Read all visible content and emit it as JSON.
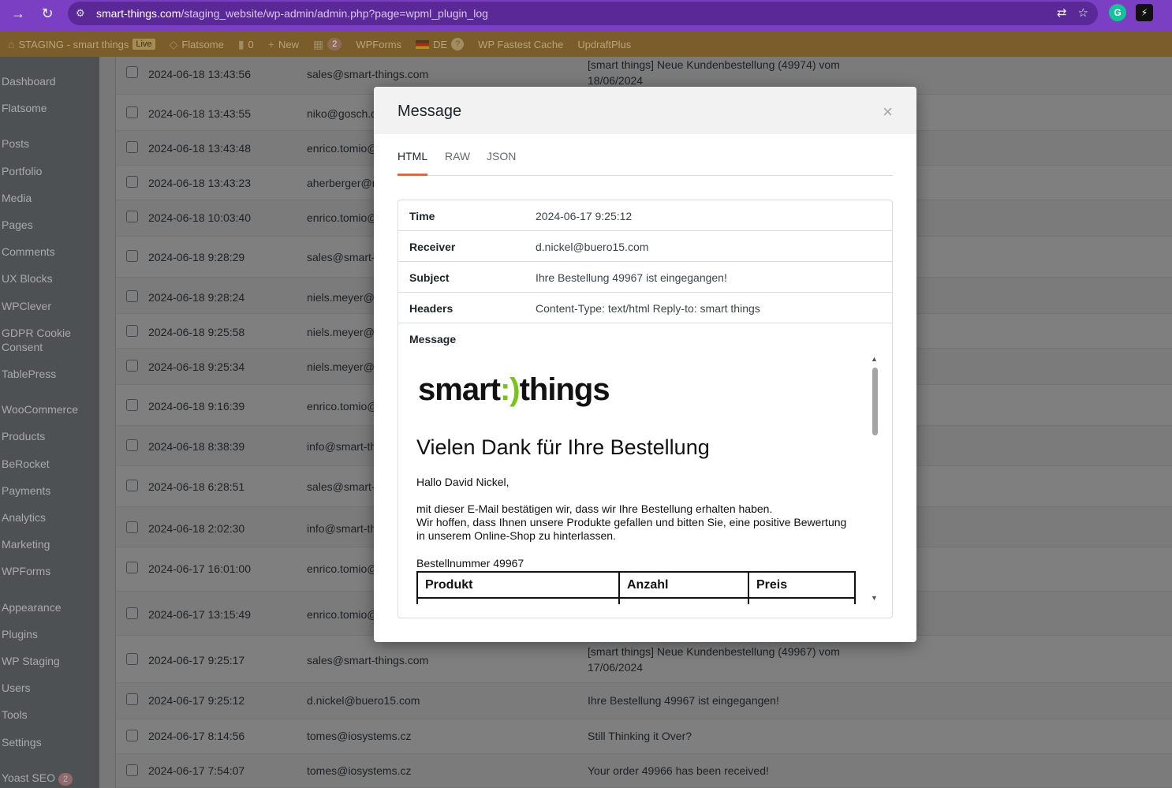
{
  "browser": {
    "url_host": "smart-things.com",
    "url_path": "/staging_website/wp-admin/admin.php?page=wpml_plugin_log"
  },
  "admin_bar": {
    "site_name": "STAGING - smart things",
    "live": "Live",
    "flatsome": "Flatsome",
    "comments_count": "0",
    "new": "New",
    "updates_count": "2",
    "wpforms": "WPForms",
    "lang": "DE",
    "fastest_cache": "WP Fastest Cache",
    "updraft": "UpdraftPlus"
  },
  "sidebar": {
    "items": [
      {
        "label": "Dashboard"
      },
      {
        "label": "Flatsome"
      },
      {
        "label": "Posts"
      },
      {
        "label": "Portfolio"
      },
      {
        "label": "Media"
      },
      {
        "label": "Pages"
      },
      {
        "label": "Comments"
      },
      {
        "label": "UX Blocks"
      },
      {
        "label": "WPClever"
      },
      {
        "label": "GDPR Cookie Consent"
      },
      {
        "label": "TablePress"
      },
      {
        "label": "WooCommerce"
      },
      {
        "label": "Products"
      },
      {
        "label": "BeRocket"
      },
      {
        "label": "Payments"
      },
      {
        "label": "Analytics"
      },
      {
        "label": "Marketing"
      },
      {
        "label": "WPForms"
      },
      {
        "label": "Appearance"
      },
      {
        "label": "Plugins"
      },
      {
        "label": "WP Staging"
      },
      {
        "label": "Users"
      },
      {
        "label": "Tools"
      },
      {
        "label": "Settings"
      },
      {
        "label": "Yoast SEO",
        "badge": "2"
      }
    ]
  },
  "rows": [
    {
      "time": "2024-06-18 13:43:56",
      "receiver": "sales@smart-things.com",
      "subject": "[smart things] Neue Kundenbestellung (49974) vom 18/06/2024"
    },
    {
      "time": "2024-06-18 13:43:55",
      "receiver": "niko@gosch.de",
      "subject": ""
    },
    {
      "time": "2024-06-18 13:43:48",
      "receiver": "enrico.tomio@",
      "subject": ""
    },
    {
      "time": "2024-06-18 13:43:23",
      "receiver": "aherberger@m",
      "subject": ""
    },
    {
      "time": "2024-06-18 10:03:40",
      "receiver": "enrico.tomio@",
      "subject": ""
    },
    {
      "time": "2024-06-18 9:28:29",
      "receiver": "sales@smart-t",
      "subject": ""
    },
    {
      "time": "2024-06-18 9:28:24",
      "receiver": "niels.meyer@",
      "subject": ""
    },
    {
      "time": "2024-06-18 9:25:58",
      "receiver": "niels.meyer@",
      "subject": ""
    },
    {
      "time": "2024-06-18 9:25:34",
      "receiver": "niels.meyer@",
      "subject": ""
    },
    {
      "time": "2024-06-18 9:16:39",
      "receiver": "enrico.tomio@",
      "subject": ""
    },
    {
      "time": "2024-06-18 8:38:39",
      "receiver": "info@smart-th",
      "subject": ""
    },
    {
      "time": "2024-06-18 6:28:51",
      "receiver": "sales@smart-t",
      "subject": ""
    },
    {
      "time": "2024-06-18 2:02:30",
      "receiver": "info@smart-th",
      "subject": ""
    },
    {
      "time": "2024-06-17 16:01:00",
      "receiver": "enrico.tomio@",
      "subject": ""
    },
    {
      "time": "2024-06-17 13:15:49",
      "receiver": "enrico.tomio@",
      "subject": ""
    },
    {
      "time": "2024-06-17 9:25:17",
      "receiver": "sales@smart-things.com",
      "subject": "[smart things] Neue Kundenbestellung (49967) vom 17/06/2024"
    },
    {
      "time": "2024-06-17 9:25:12",
      "receiver": "d.nickel@buero15.com",
      "subject": "Ihre Bestellung 49967 ist eingegangen!"
    },
    {
      "time": "2024-06-17 8:14:56",
      "receiver": "tomes@iosystems.cz",
      "subject": "Still Thinking it Over?"
    },
    {
      "time": "2024-06-17 7:54:07",
      "receiver": "tomes@iosystems.cz",
      "subject": "Your order 49966 has been received!"
    }
  ],
  "modal": {
    "title": "Message",
    "close": "×",
    "tabs": [
      "HTML",
      "RAW",
      "JSON"
    ],
    "fields": [
      {
        "key": "Time",
        "value": "2024-06-17 9:25:12"
      },
      {
        "key": "Receiver",
        "value": "d.nickel@buero15.com"
      },
      {
        "key": "Subject",
        "value": "Ihre Bestellung 49967 ist eingegangen!"
      },
      {
        "key": "Headers",
        "value": "Content-Type: text/html Reply-to: smart things"
      }
    ],
    "message_label": "Message",
    "email": {
      "logo_left": "smart",
      "logo_smile": ":)",
      "logo_right": "things",
      "heading": "Vielen Dank für Ihre Bestellung",
      "greeting": "Hallo David Nickel,",
      "para1": "mit dieser E-Mail bestätigen wir, dass wir Ihre Bestellung erhalten haben.",
      "para2": "Wir hoffen, dass Ihnen unsere Produkte gefallen und bitten Sie, eine positive Bewertung in unserem Online-Shop zu hinterlassen.",
      "order_number": "Bestellnummer 49967",
      "table_headers": [
        "Produkt",
        "Anzahl",
        "Preis"
      ]
    }
  }
}
